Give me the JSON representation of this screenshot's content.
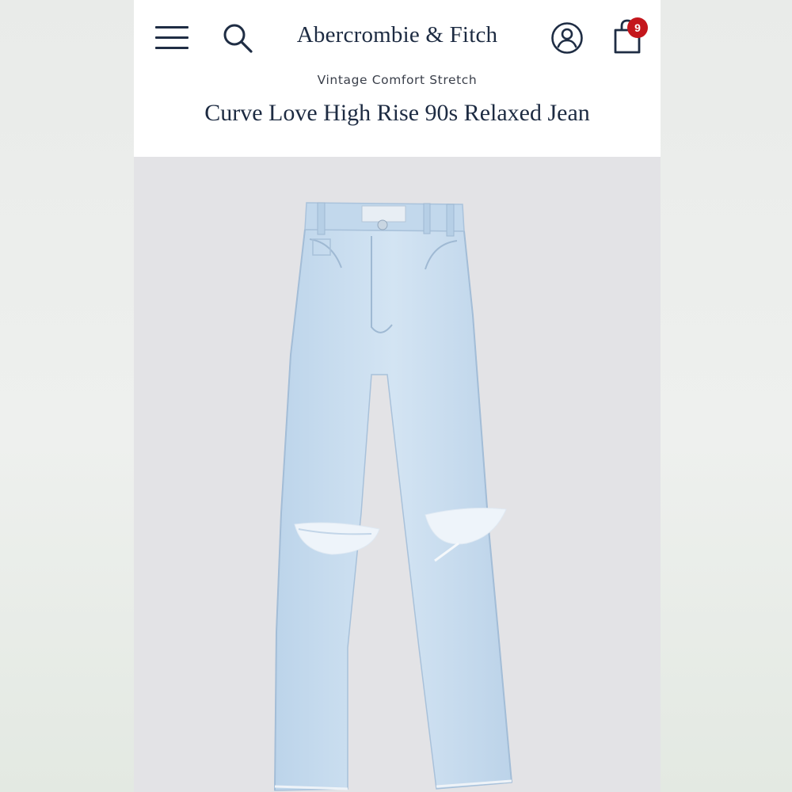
{
  "header": {
    "logo": "Abercrombie & Fitch",
    "bag_count": "9",
    "icons": [
      "menu-icon",
      "search-icon",
      "account-icon",
      "shopping-bag-icon"
    ]
  },
  "product": {
    "collection": "Vintage Comfort Stretch",
    "title": "Curve Love High Rise 90s Relaxed Jean"
  },
  "colors": {
    "brand_navy": "#1d2b42",
    "badge_red": "#c4161c",
    "denim": "#c9def0",
    "image_bg": "#e3e3e6"
  }
}
